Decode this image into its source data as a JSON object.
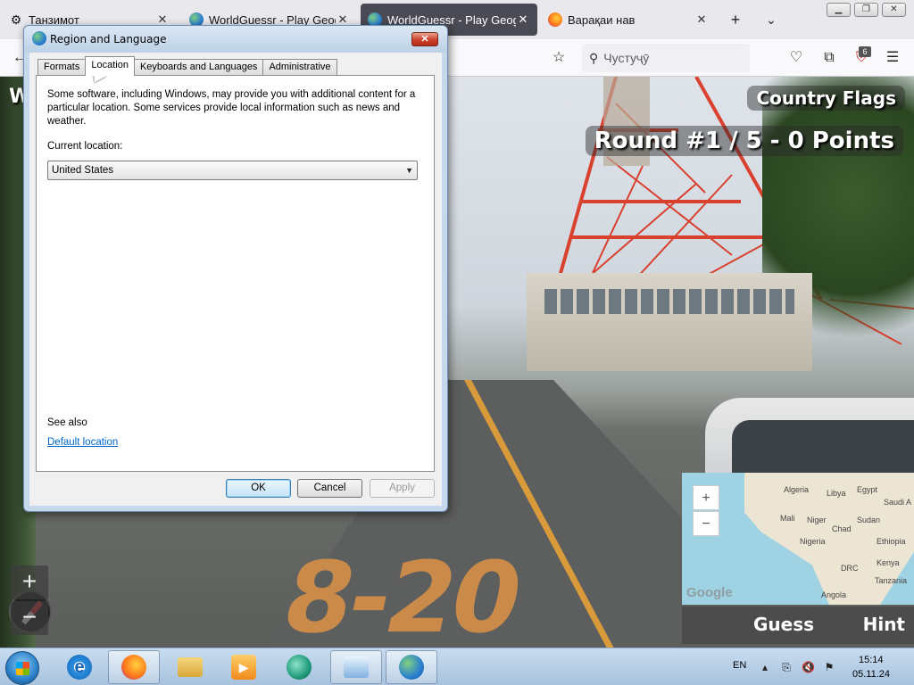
{
  "browser": {
    "tabs": [
      {
        "title": "Танзимот",
        "icon": "gear-icon"
      },
      {
        "title": "WorldGuessr - Play Geogu",
        "icon": "globe-icon"
      },
      {
        "title": "WorldGuessr - Play Geogu",
        "icon": "globe-icon"
      },
      {
        "title": "Варақаи нав",
        "icon": "firefox-icon"
      }
    ],
    "new_tab_symbol": "+",
    "search_placeholder": "Чустуҷӯ",
    "extensions_badge": "6"
  },
  "game": {
    "title_partial": "W",
    "mode": "Country Flags",
    "round_info": "Round #1 / 5 - 0 Points",
    "guess_label": "Guess",
    "hint_label": "Hint",
    "zoom_in": "+",
    "zoom_out": "−",
    "road_marking": "8-20",
    "map_labels": [
      "Algeria",
      "Libya",
      "Egypt",
      "Saudi A",
      "Mali",
      "Niger",
      "Sudan",
      "Chad",
      "Nigeria",
      "Ethiopia",
      "DRC",
      "Kenya",
      "Tanzania",
      "Angola"
    ],
    "map_logo": "Google"
  },
  "dialog": {
    "title": "Region and Language",
    "close_symbol": "✕",
    "tabs": [
      "Formats",
      "Location",
      "Keyboards and Languages",
      "Administrative"
    ],
    "active_tab": "Location",
    "description": "Some software, including Windows, may provide you with additional content for a particular location. Some services provide local information such as news and weather.",
    "current_location_label": "Current location:",
    "current_location_value": "United States",
    "see_also_label": "See also",
    "default_location_link": "Default location",
    "buttons": {
      "ok": "OK",
      "cancel": "Cancel",
      "apply": "Apply"
    }
  },
  "taskbar": {
    "language": "EN",
    "time": "15:14",
    "date": "05.11.24"
  },
  "colors": {
    "accent": "#0066cc",
    "dialog_frame": "#c6d9ec",
    "close_red": "#c9402a",
    "taskbar": "#b7cfe6"
  }
}
